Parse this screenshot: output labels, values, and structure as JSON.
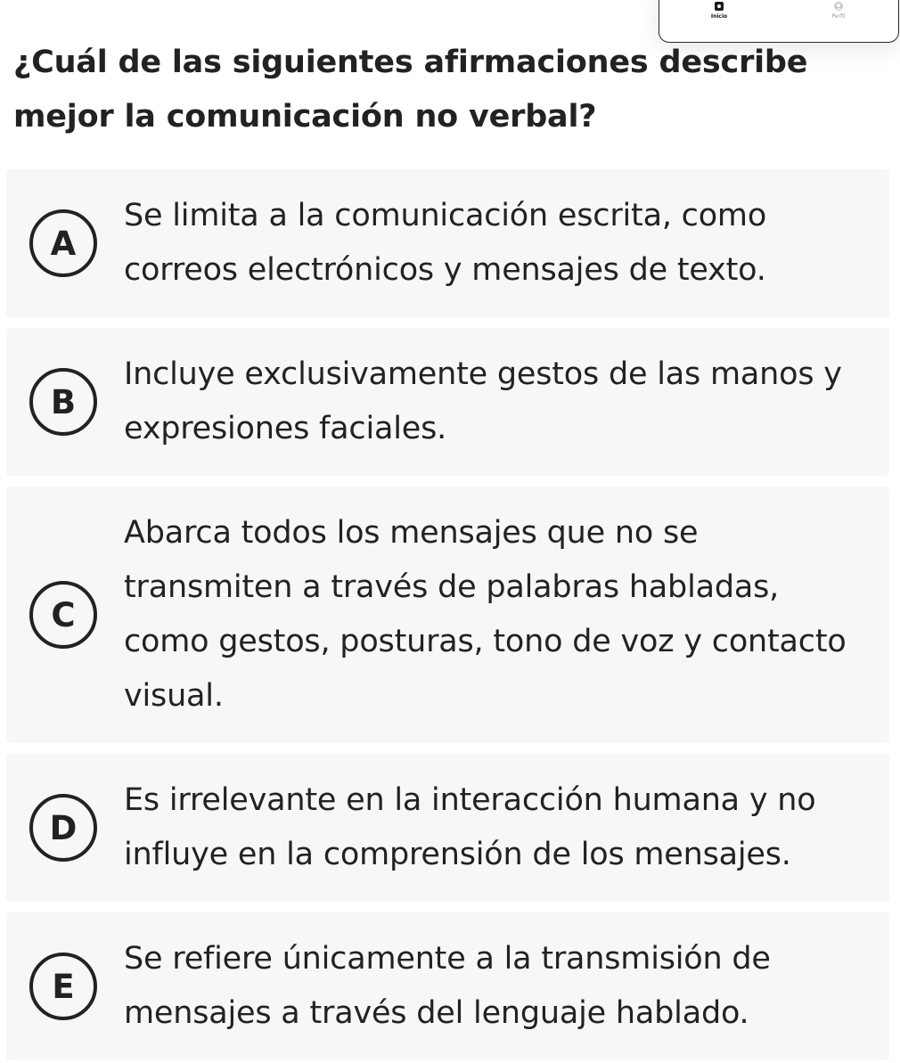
{
  "nav": {
    "items": [
      {
        "label": "Inicio",
        "icon": "home-icon",
        "active": true
      },
      {
        "label": "Perfil",
        "icon": "profile-icon",
        "active": false
      }
    ]
  },
  "question": {
    "text": "¿Cuál de las siguientes afirmaciones describe mejor la comunicación no verbal?"
  },
  "options": [
    {
      "letter": "A",
      "text": "Se limita a la comunicación escrita, como correos electrónicos y mensajes de texto."
    },
    {
      "letter": "B",
      "text": "Incluye exclusivamente gestos de las manos y expresiones faciales."
    },
    {
      "letter": "C",
      "text": "Abarca todos los mensajes que no se transmiten a través de palabras habladas, como gestos, posturas, tono de voz y contacto visual."
    },
    {
      "letter": "D",
      "text": "Es irrelevante en la interacción humana y no influye en la comprensión de los mensajes."
    },
    {
      "letter": "E",
      "text": "Se refiere únicamente a la transmisión de mensajes a través del lenguaje hablado."
    }
  ],
  "colors": {
    "text": "#222222",
    "option_background": "#f7f7f7",
    "page_background": "#ffffff"
  }
}
